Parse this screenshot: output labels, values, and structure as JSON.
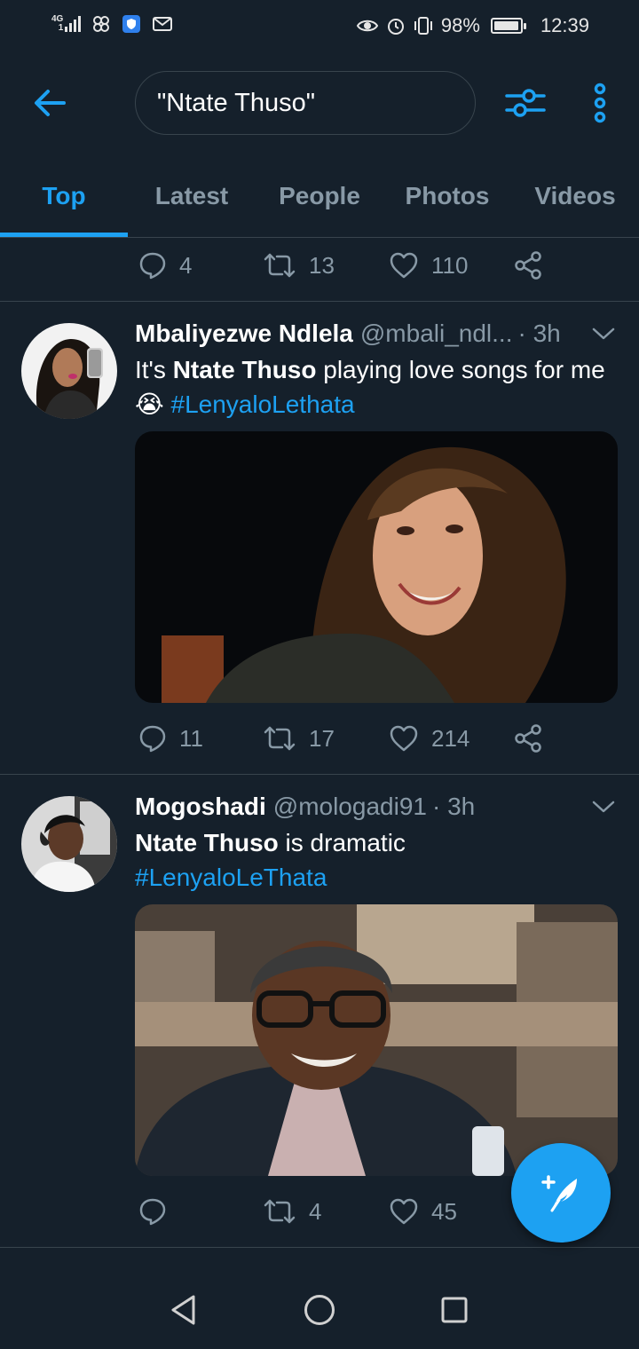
{
  "status_bar": {
    "network": "4G",
    "network_sub": "1",
    "battery": "98%",
    "battery_fraction": 0.98,
    "time": "12:39",
    "icons": [
      "signal-icon",
      "pinwheel-icon",
      "shield-icon",
      "mail-icon",
      "eye-icon",
      "alarm-icon",
      "vibrate-icon",
      "battery-icon"
    ]
  },
  "header": {
    "back_icon": "arrow-left-icon",
    "search_query": "\"Ntate Thuso\"",
    "filter_icon": "sliders-icon",
    "more_icon": "more-vertical-icon"
  },
  "tabs": [
    {
      "label": "Top",
      "active": true
    },
    {
      "label": "Latest",
      "active": false
    },
    {
      "label": "People",
      "active": false
    },
    {
      "label": "Photos",
      "active": false
    },
    {
      "label": "Videos",
      "active": false
    }
  ],
  "previous_tweet_actions": {
    "replies": "4",
    "retweets": "13",
    "likes": "110"
  },
  "tweets": [
    {
      "author": "Mbaliyezwe Ndlela",
      "handle": "@mbali_ndl...",
      "time": "· 3h",
      "text_before": "It's ",
      "text_bold": "Ntate Thuso",
      "text_after": " playing love songs for me",
      "emoji": "😭",
      "hashtag": "#LenyaloLethata",
      "replies": "11",
      "retweets": "17",
      "likes": "214"
    },
    {
      "author": "Mogoshadi",
      "handle": "@mologadi91",
      "time": "· 3h",
      "text_bold": "Ntate Thuso",
      "text_after": " is dramatic",
      "hashtag": "#LenyaloLeThata",
      "replies": "",
      "retweets": "4",
      "likes": "45"
    }
  ],
  "colors": {
    "background": "#15202b",
    "accent": "#1da1f2",
    "secondary_text": "#8899a6",
    "divider": "#38444d"
  }
}
